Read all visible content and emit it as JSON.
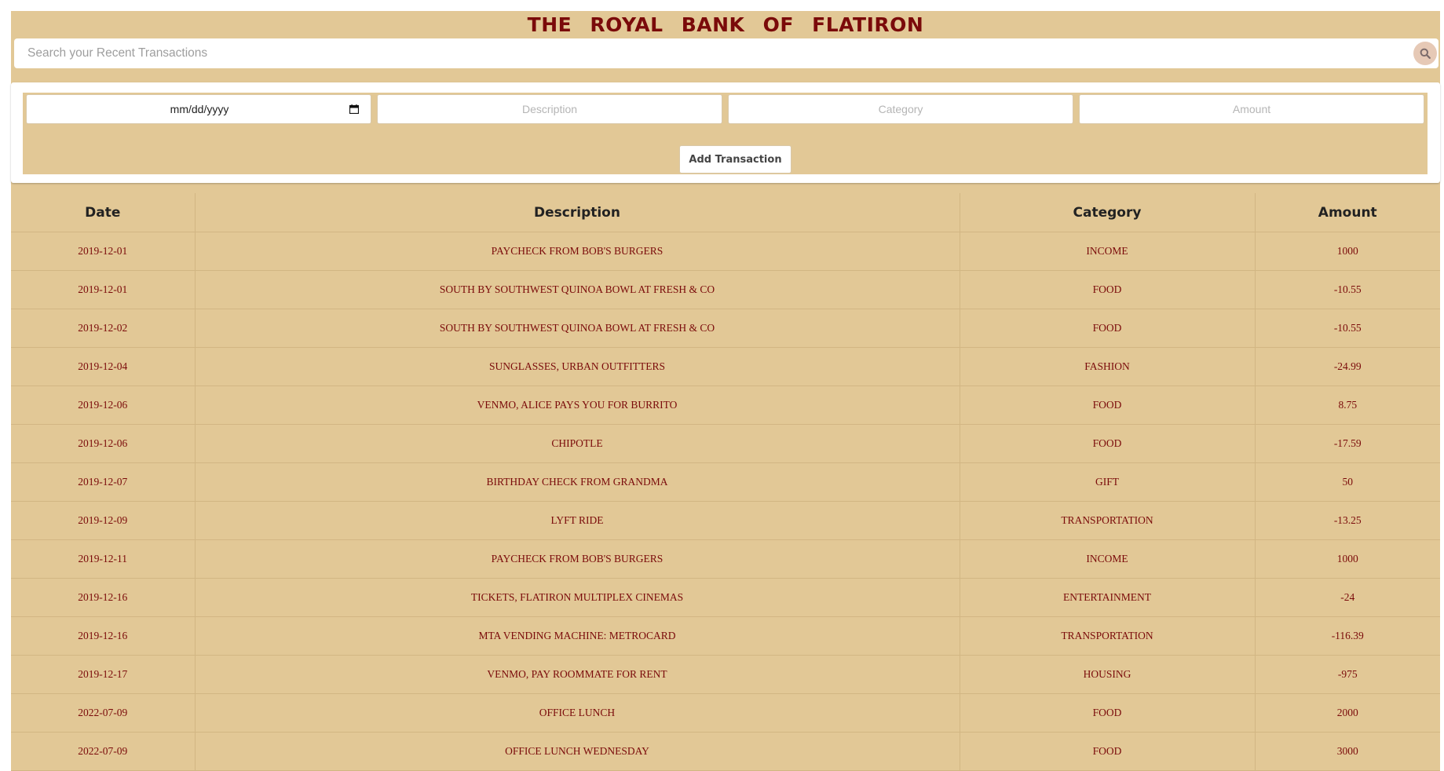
{
  "app": {
    "title": "THE ROYAL BANK OF FLATIRON"
  },
  "search": {
    "placeholder": "Search your Recent Transactions",
    "icon": "search-icon"
  },
  "form": {
    "date_value": "mm/dd/yyyy",
    "description_placeholder": "Description",
    "category_placeholder": "Category",
    "amount_placeholder": "Amount",
    "submit_label": "Add Transaction"
  },
  "table": {
    "headers": [
      "Date",
      "Description",
      "Category",
      "Amount"
    ],
    "rows": [
      {
        "date": "2019-12-01",
        "description": "PAYCHECK FROM BOB'S BURGERS",
        "category": "INCOME",
        "amount": "1000"
      },
      {
        "date": "2019-12-01",
        "description": "SOUTH BY SOUTHWEST QUINOA BOWL AT FRESH & CO",
        "category": "FOOD",
        "amount": "-10.55"
      },
      {
        "date": "2019-12-02",
        "description": "SOUTH BY SOUTHWEST QUINOA BOWL AT FRESH & CO",
        "category": "FOOD",
        "amount": "-10.55"
      },
      {
        "date": "2019-12-04",
        "description": "SUNGLASSES, URBAN OUTFITTERS",
        "category": "FASHION",
        "amount": "-24.99"
      },
      {
        "date": "2019-12-06",
        "description": "VENMO, ALICE PAYS YOU FOR BURRITO",
        "category": "FOOD",
        "amount": "8.75"
      },
      {
        "date": "2019-12-06",
        "description": "CHIPOTLE",
        "category": "FOOD",
        "amount": "-17.59"
      },
      {
        "date": "2019-12-07",
        "description": "BIRTHDAY CHECK FROM GRANDMA",
        "category": "GIFT",
        "amount": "50"
      },
      {
        "date": "2019-12-09",
        "description": "LYFT RIDE",
        "category": "TRANSPORTATION",
        "amount": "-13.25"
      },
      {
        "date": "2019-12-11",
        "description": "PAYCHECK FROM BOB'S BURGERS",
        "category": "INCOME",
        "amount": "1000"
      },
      {
        "date": "2019-12-16",
        "description": "TICKETS, FLATIRON MULTIPLEX CINEMAS",
        "category": "ENTERTAINMENT",
        "amount": "-24"
      },
      {
        "date": "2019-12-16",
        "description": "MTA VENDING MACHINE: METROCARD",
        "category": "TRANSPORTATION",
        "amount": "-116.39"
      },
      {
        "date": "2019-12-17",
        "description": "VENMO, PAY ROOMMATE FOR RENT",
        "category": "HOUSING",
        "amount": "-975"
      },
      {
        "date": "2022-07-09",
        "description": "OFFICE LUNCH",
        "category": "FOOD",
        "amount": "2000"
      },
      {
        "date": "2022-07-09",
        "description": "OFFICE LUNCH WEDNESDAY",
        "category": "FOOD",
        "amount": "3000"
      }
    ]
  },
  "colors": {
    "background": "#e2c896",
    "accent": "#7a0a0a"
  }
}
